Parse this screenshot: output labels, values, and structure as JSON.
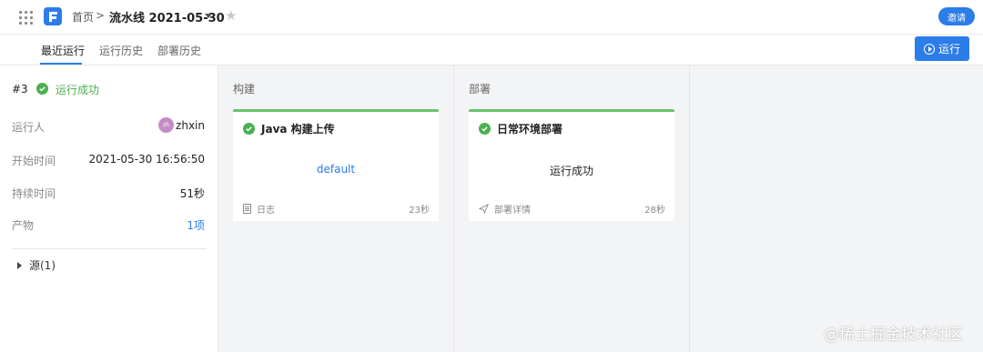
{
  "header": {
    "breadcrumb_home": "首页",
    "breadcrumb_separator": ">",
    "pipeline_title": "流水线 2021-05-30",
    "invite_label": "邀请"
  },
  "tabs": [
    {
      "label": "最近运行",
      "active": true
    },
    {
      "label": "运行历史",
      "active": false
    },
    {
      "label": "部署历史",
      "active": false
    }
  ],
  "run_button_label": "运行",
  "run_summary": {
    "number": "#3",
    "status": "运行成功",
    "runner_label": "运行人",
    "runner_avatar": "zh",
    "runner_name": "zhxin",
    "start_label": "开始时间",
    "start_value": "2021-05-30 16:56:50",
    "duration_label": "持续时间",
    "duration_value": "51秒",
    "artifacts_label": "产物",
    "artifacts_value": "1项",
    "source_label": "源(1)"
  },
  "stages": [
    {
      "title": "构建",
      "job": {
        "name": "Java 构建上传",
        "center_text": "default",
        "footer_label": "日志",
        "footer_icon": "log-icon",
        "duration": "23秒"
      }
    },
    {
      "title": "部署",
      "job": {
        "name": "日常环境部署",
        "center_text": "运行成功",
        "footer_label": "部署详情",
        "footer_icon": "send-icon",
        "duration": "28秒"
      }
    }
  ],
  "watermark": "@稀土掘金技术社区",
  "colors": {
    "accent": "#2b7de9",
    "success": "#4caf50",
    "card_border": "#6ac16e"
  }
}
